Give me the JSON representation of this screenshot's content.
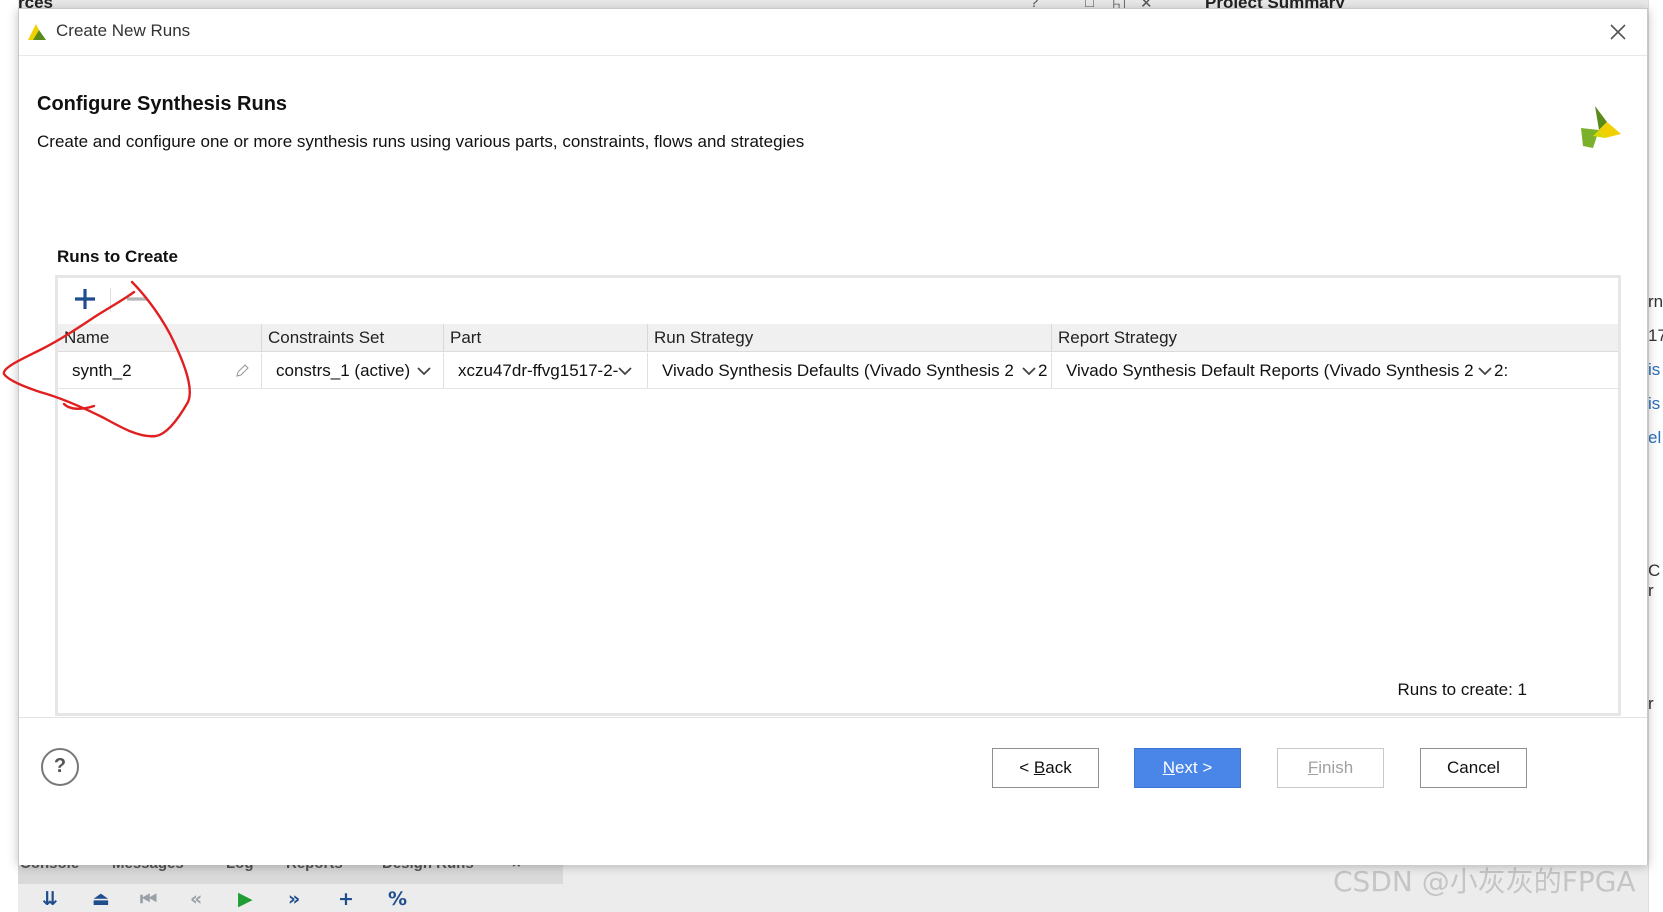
{
  "background": {
    "top_fragments": [
      "rces",
      "Project Summary"
    ],
    "right_fragments": [
      "rn",
      "17",
      "is",
      "is",
      "el",
      "C r",
      "r"
    ],
    "bottom_tabs": [
      "Console",
      "Messages",
      "Log",
      "Reports",
      "Design Runs"
    ],
    "watermark": "CSDN @小灰灰的FPGA"
  },
  "dialog": {
    "window_title": "Create New Runs",
    "header_title": "Configure Synthesis Runs",
    "header_subtitle": "Create and configure one or more synthesis runs using various parts, constraints, flows and strategies",
    "section_label": "Runs to Create",
    "toolbar": {
      "add_label": "+",
      "remove_label": "−"
    },
    "columns": [
      "Name",
      "Constraints Set",
      "Part",
      "Run Strategy",
      "Report Strategy"
    ],
    "rows": [
      {
        "name": "synth_2",
        "constraints_set": "constrs_1 (active)",
        "part": "xczu47dr-ffvg1517-2-",
        "run_strategy": "Vivado Synthesis Defaults (Vivado Synthesis 2",
        "run_strategy_tail": "2",
        "report_strategy": "Vivado Synthesis Default Reports (Vivado Synthesis 2",
        "report_strategy_tail": "2:"
      }
    ],
    "runs_to_create": "Runs to create: 1",
    "buttons": {
      "help": "?",
      "back_prefix": "< ",
      "back_key": "B",
      "back_rest": "ack",
      "next_key": "N",
      "next_rest": "ext >",
      "finish_key": "F",
      "finish_rest": "inish",
      "cancel": "Cancel"
    },
    "colors": {
      "accent": "#4a86e8",
      "plus_icon": "#1f4e8c",
      "annotation": "#e02020",
      "logo_yellow": "#f0d000",
      "logo_green": "#5a8a1a"
    }
  }
}
